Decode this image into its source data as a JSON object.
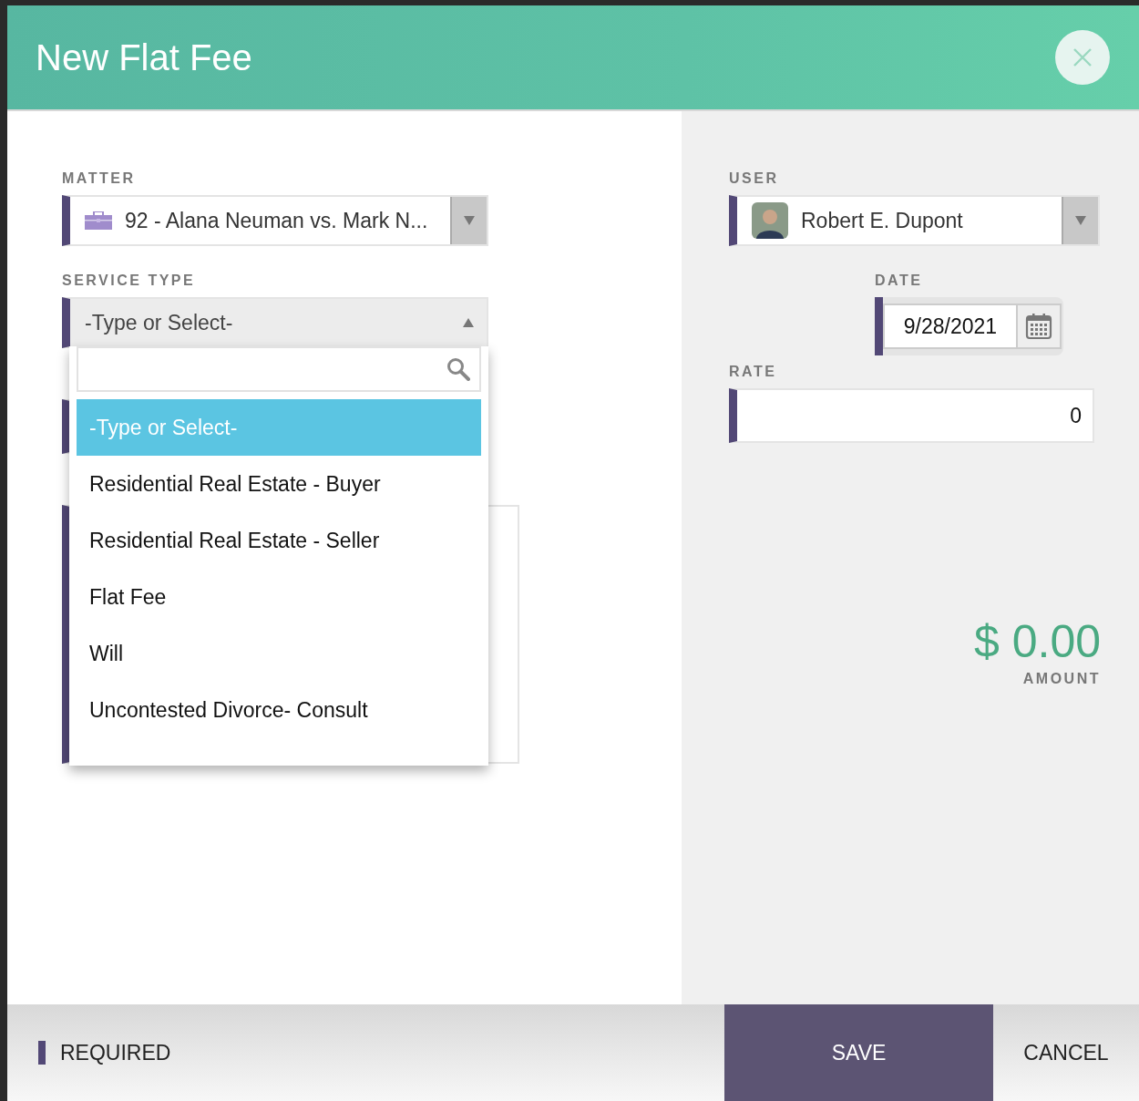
{
  "dialog": {
    "title": "New Flat Fee"
  },
  "matter": {
    "label": "MATTER",
    "value": "92 - Alana Neuman vs. Mark N...",
    "required": true
  },
  "service_type": {
    "label": "SERVICE TYPE",
    "value": "-Type or Select-",
    "required": true,
    "open": true,
    "options": [
      {
        "label": "-Type or Select-",
        "selected": true
      },
      {
        "label": "Residential Real Estate - Buyer",
        "selected": false
      },
      {
        "label": "Residential Real Estate - Seller",
        "selected": false
      },
      {
        "label": "Flat Fee",
        "selected": false
      },
      {
        "label": "Will",
        "selected": false
      },
      {
        "label": "Uncontested Divorce- Consult",
        "selected": false
      }
    ]
  },
  "hidden_fields": [
    {
      "kind": "input",
      "required": true
    },
    {
      "kind": "textarea",
      "required": true
    }
  ],
  "user": {
    "label": "USER",
    "value": "Robert E. Dupont",
    "required": true
  },
  "date": {
    "label": "DATE",
    "value": "9/28/2021",
    "required": true
  },
  "rate": {
    "label": "RATE",
    "value": "0",
    "required": true
  },
  "amount": {
    "value": "$ 0.00",
    "label": "AMOUNT"
  },
  "footer": {
    "required_label": "REQUIRED",
    "buttons": [
      {
        "label": "SAVE",
        "kind": "primary"
      },
      {
        "label": "CANCEL",
        "kind": "secondary"
      }
    ]
  }
}
